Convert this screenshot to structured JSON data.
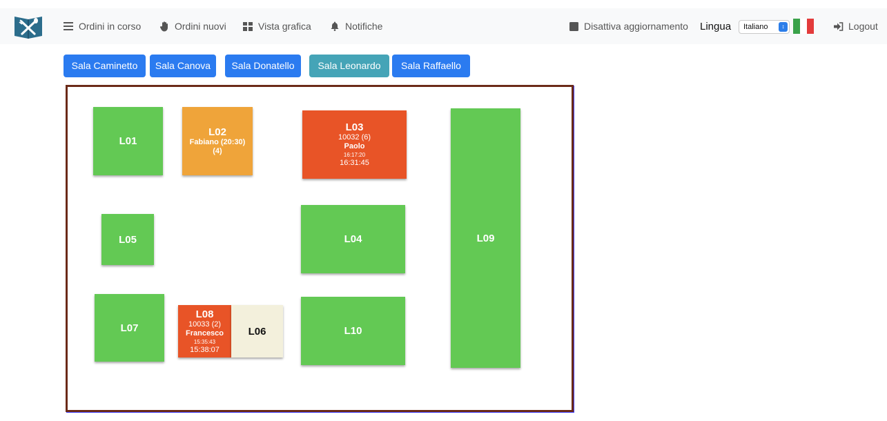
{
  "navbar": {
    "items": [
      {
        "label": "Ordini in corso",
        "icon": "list-icon"
      },
      {
        "label": "Ordini nuovi",
        "icon": "hand-icon"
      },
      {
        "label": "Vista grafica",
        "icon": "grid-icon"
      },
      {
        "label": "Notifiche",
        "icon": "bell-icon"
      }
    ],
    "refresh_toggle": "Disattiva aggiornamento",
    "language_label": "Lingua",
    "language_value": "Italiano",
    "logout": "Logout"
  },
  "rooms": [
    {
      "label": "Sala Caminetto",
      "active": false
    },
    {
      "label": "Sala Canova",
      "active": false
    },
    {
      "label": "Sala Donatello",
      "active": false
    },
    {
      "label": "Sala Leonardo",
      "active": true
    },
    {
      "label": "Sala Raffaello",
      "active": false
    }
  ],
  "colors": {
    "free": "#63c954",
    "reserved": "#efa43a",
    "busy": "#e85427",
    "idle": "#f3f0dc",
    "room_tab": "#2b7bf0",
    "room_tab_active": "#45a4b7"
  },
  "tables": {
    "l01": {
      "name": "L01",
      "status": "free"
    },
    "l02": {
      "name": "L02",
      "status": "reserved",
      "reservation": "Fabiano (20:30)",
      "guests": "(4)"
    },
    "l03": {
      "name": "L03",
      "status": "busy",
      "order": "10032 (6)",
      "waiter": "Paolo",
      "opened": "16:17:20",
      "last_update": "16:31:45"
    },
    "l04": {
      "name": "L04",
      "status": "free"
    },
    "l05": {
      "name": "L05",
      "status": "free"
    },
    "l06": {
      "name": "L06",
      "status": "idle"
    },
    "l07": {
      "name": "L07",
      "status": "free"
    },
    "l08": {
      "name": "L08",
      "status": "busy",
      "order": "10033 (2)",
      "waiter": "Francesco",
      "opened": "15:35:43",
      "last_update": "15:38:07"
    },
    "l09": {
      "name": "L09",
      "status": "free"
    },
    "l10": {
      "name": "L10",
      "status": "free"
    }
  }
}
